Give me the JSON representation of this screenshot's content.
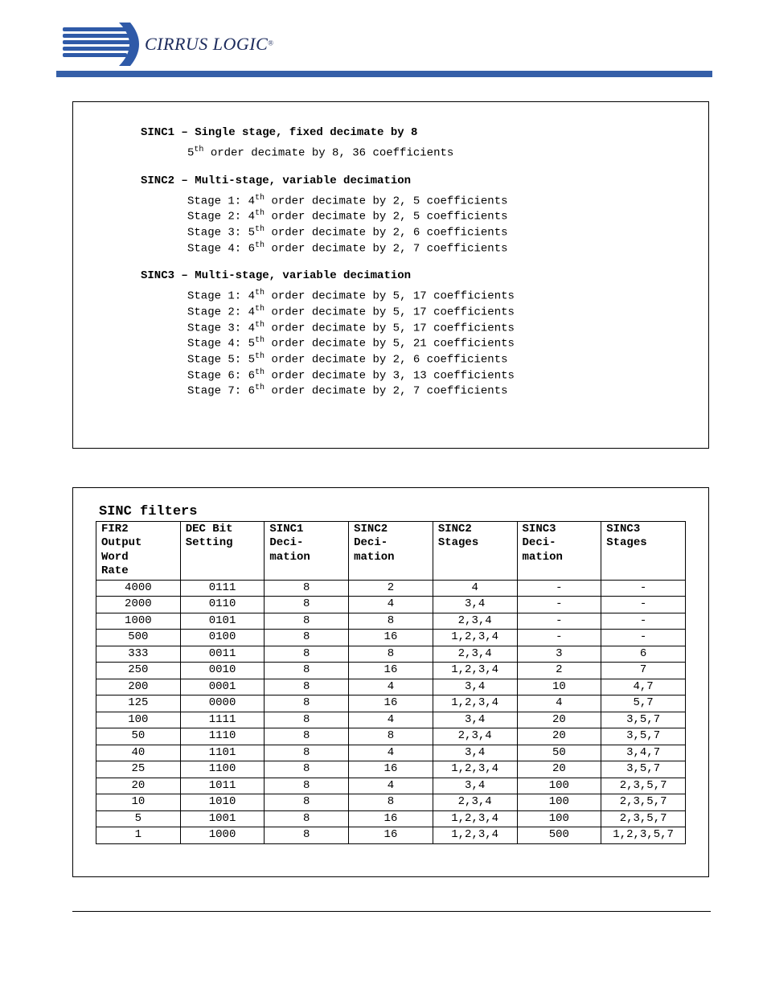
{
  "logo": {
    "name": "CIRRUS LOGIC"
  },
  "box1": {
    "sinc1": {
      "title": "SINC1 – Single stage, fixed decimate by 8",
      "line": "5th order decimate by 8, 36 coefficients",
      "ord": "5",
      "ord_suf": "th",
      "rest": " order decimate by 8, 36 coefficients"
    },
    "sinc2": {
      "title": "SINC2 – Multi-stage, variable decimation",
      "stages": [
        {
          "pre": "Stage 1: ",
          "ord": "4",
          "suf": "th",
          "rest": " order decimate by 2, 5 coefficients"
        },
        {
          "pre": "Stage 2: ",
          "ord": "4",
          "suf": "th",
          "rest": " order decimate by 2, 5 coefficients"
        },
        {
          "pre": "Stage 3: ",
          "ord": "5",
          "suf": "th",
          "rest": " order decimate by 2, 6 coefficients"
        },
        {
          "pre": "Stage 4: ",
          "ord": "6",
          "suf": "th",
          "rest": " order decimate by 2, 7 coefficients"
        }
      ]
    },
    "sinc3": {
      "title": "SINC3 – Multi-stage, variable decimation",
      "stages": [
        {
          "pre": "Stage 1: ",
          "ord": "4",
          "suf": "th",
          "rest": " order decimate by 5, 17 coefficients"
        },
        {
          "pre": "Stage 2: ",
          "ord": "4",
          "suf": "th",
          "rest": " order decimate by 5, 17 coefficients"
        },
        {
          "pre": "Stage 3: ",
          "ord": "4",
          "suf": "th",
          "rest": " order decimate by 5, 17 coefficients"
        },
        {
          "pre": "Stage 4: ",
          "ord": "5",
          "suf": "th",
          "rest": " order decimate by 5, 21 coefficients"
        },
        {
          "pre": "Stage 5: ",
          "ord": "5",
          "suf": "th",
          "rest": " order decimate by 2,  6 coefficients"
        },
        {
          "pre": "Stage 6: ",
          "ord": "6",
          "suf": "th",
          "rest": " order decimate by 3, 13 coefficients"
        },
        {
          "pre": "Stage 7: ",
          "ord": "6",
          "suf": "th",
          "rest": " order decimate by 2,  7 coefficients"
        }
      ]
    }
  },
  "table": {
    "title": "SINC filters",
    "headers": [
      "FIR2 Output Word Rate",
      "DEC Bit Setting",
      "SINC1 Deci-mation",
      "SINC2 Deci-mation",
      "SINC2 Stages",
      "SINC3 Deci-mation",
      "SINC3 Stages"
    ],
    "rows": [
      [
        "4000",
        "0111",
        "8",
        "2",
        "4",
        "-",
        "-"
      ],
      [
        "2000",
        "0110",
        "8",
        "4",
        "3,4",
        "-",
        "-"
      ],
      [
        "1000",
        "0101",
        "8",
        "8",
        "2,3,4",
        "-",
        "-"
      ],
      [
        "500",
        "0100",
        "8",
        "16",
        "1,2,3,4",
        "-",
        "-"
      ],
      [
        "333",
        "0011",
        "8",
        "8",
        "2,3,4",
        "3",
        "6"
      ],
      [
        "250",
        "0010",
        "8",
        "16",
        "1,2,3,4",
        "2",
        "7"
      ],
      [
        "200",
        "0001",
        "8",
        "4",
        "3,4",
        "10",
        "4,7"
      ],
      [
        "125",
        "0000",
        "8",
        "16",
        "1,2,3,4",
        "4",
        "5,7"
      ],
      [
        "100",
        "1111",
        "8",
        "4",
        "3,4",
        "20",
        "3,5,7"
      ],
      [
        "50",
        "1110",
        "8",
        "8",
        "2,3,4",
        "20",
        "3,5,7"
      ],
      [
        "40",
        "1101",
        "8",
        "4",
        "3,4",
        "50",
        "3,4,7"
      ],
      [
        "25",
        "1100",
        "8",
        "16",
        "1,2,3,4",
        "20",
        "3,5,7"
      ],
      [
        "20",
        "1011",
        "8",
        "4",
        "3,4",
        "100",
        "2,3,5,7"
      ],
      [
        "10",
        "1010",
        "8",
        "8",
        "2,3,4",
        "100",
        "2,3,5,7"
      ],
      [
        "5",
        "1001",
        "8",
        "16",
        "1,2,3,4",
        "100",
        "2,3,5,7"
      ],
      [
        "1",
        "1000",
        "8",
        "16",
        "1,2,3,4",
        "500",
        "1,2,3,5,7"
      ]
    ]
  }
}
